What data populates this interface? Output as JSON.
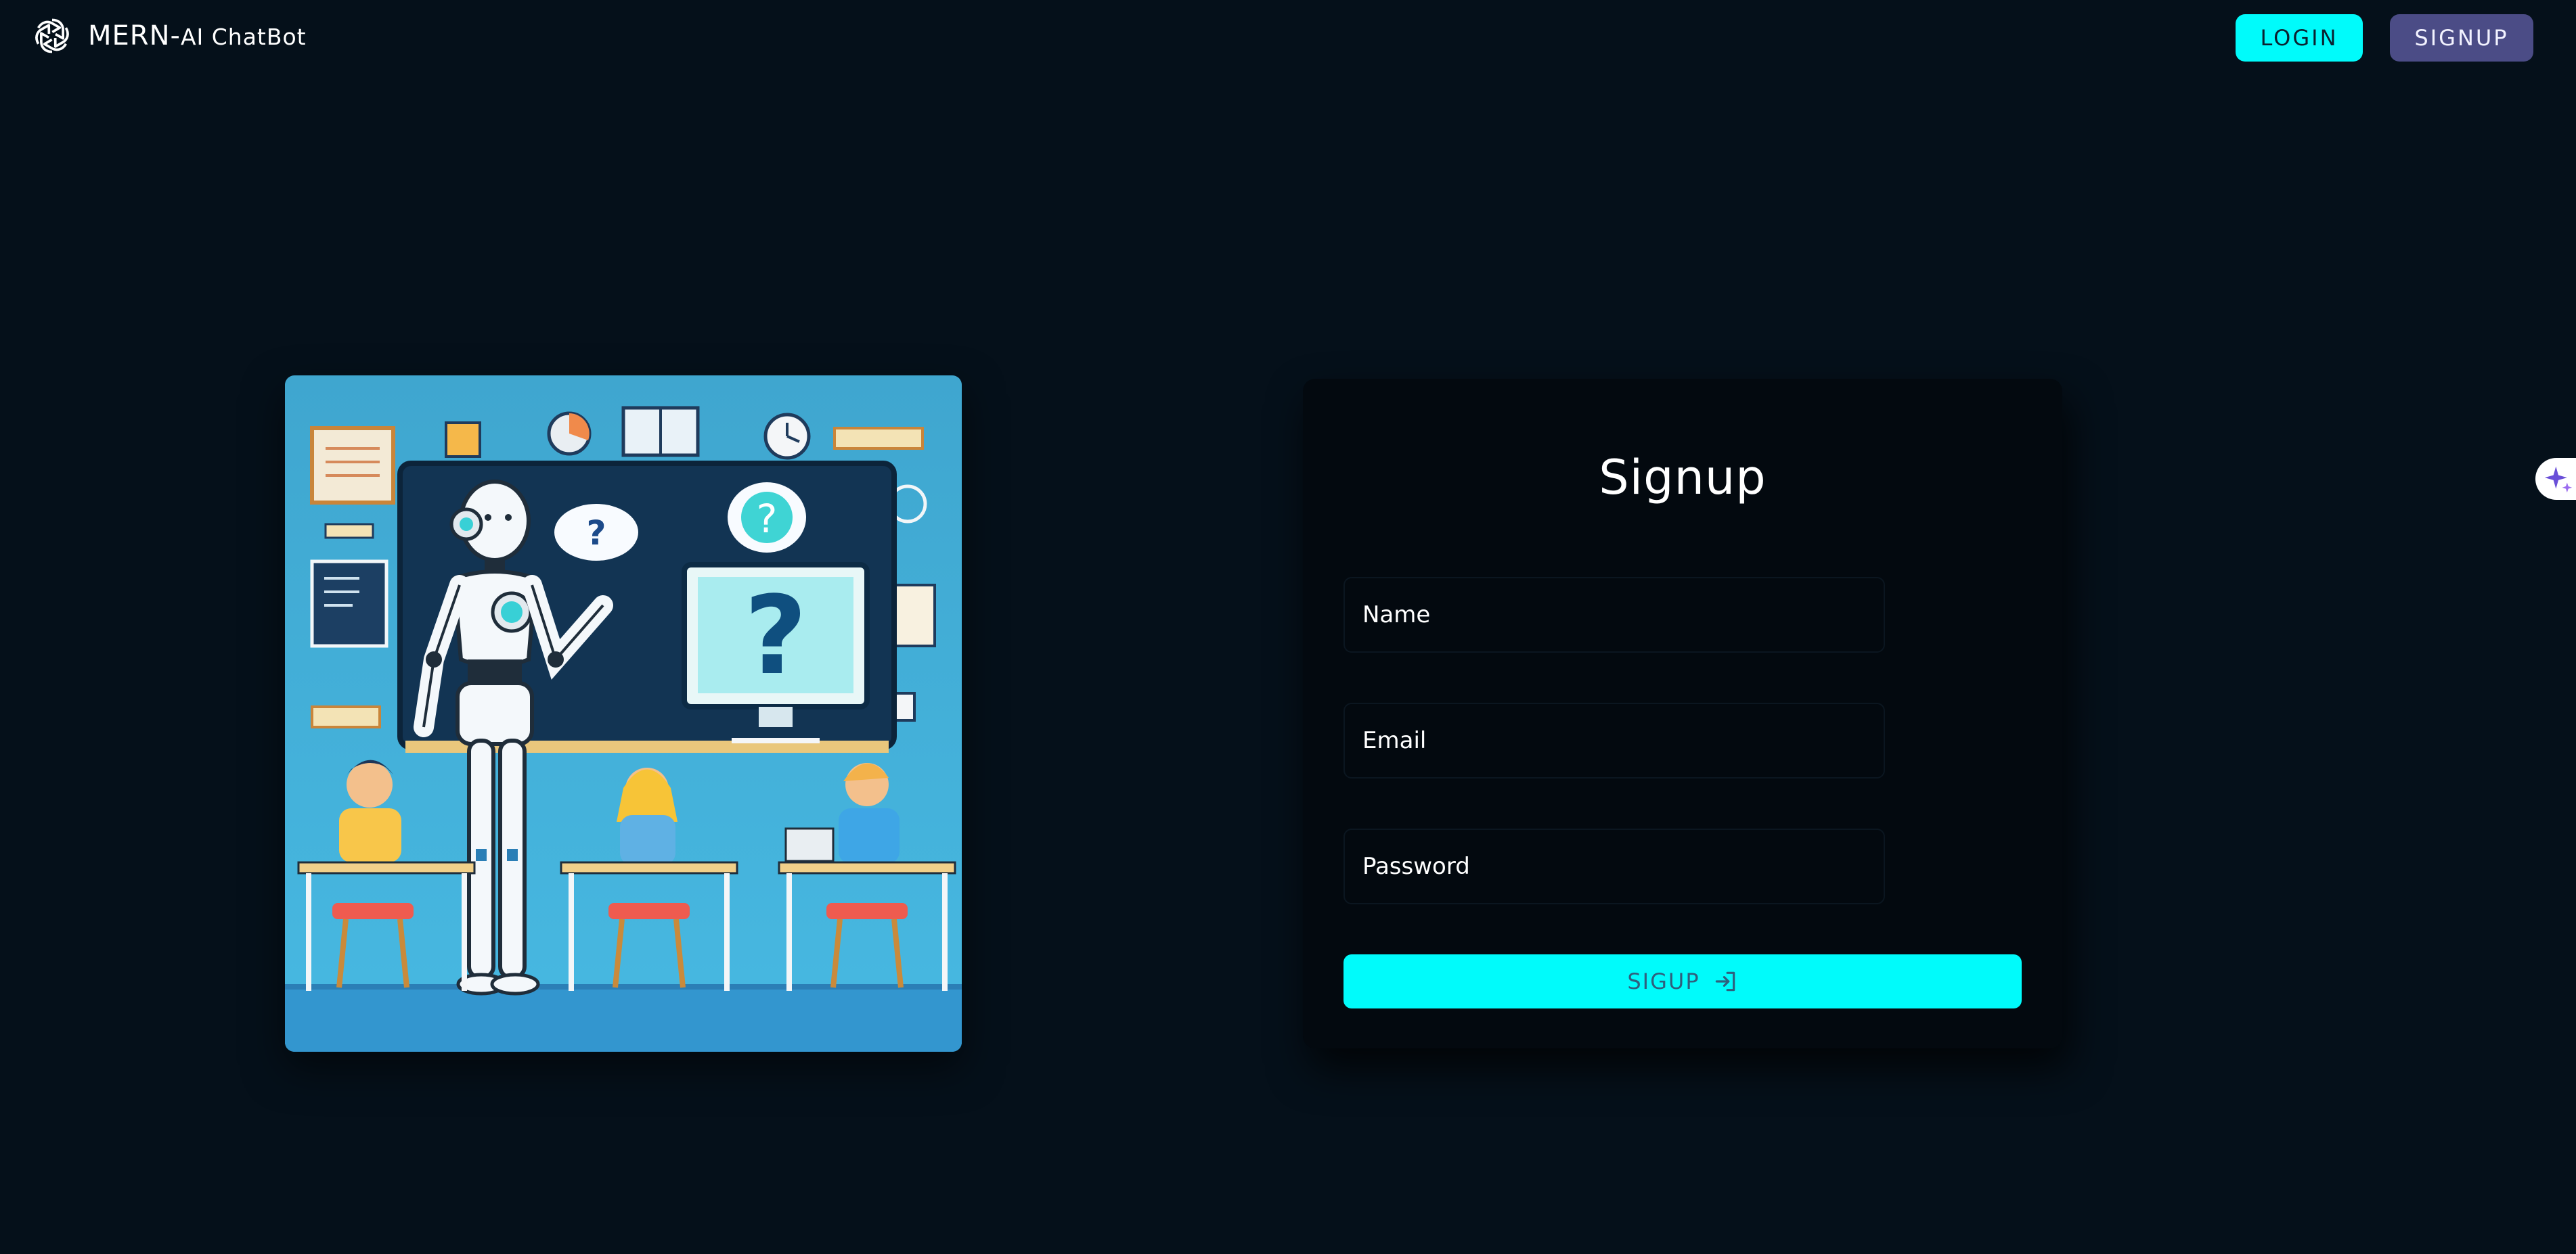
{
  "header": {
    "brand_main": "MERN-",
    "brand_sub": "AI ChatBot",
    "logo_icon": "openai-logo-icon",
    "login_label": "LOGIN",
    "signup_label": "SIGNUP"
  },
  "illustration": {
    "subject": "robot-teaching-classroom-illustration"
  },
  "signup_form": {
    "title": "Signup",
    "name_placeholder": "Name",
    "email_placeholder": "Email",
    "password_placeholder": "Password",
    "submit_label": "SIGUP",
    "submit_icon": "login-icon"
  },
  "side_widget": {
    "icon": "sparkle-icon"
  },
  "colors": {
    "background": "#05101a",
    "accent": "#00fbfb",
    "signup_nav": "#4b4c86",
    "card": "#03090f"
  }
}
